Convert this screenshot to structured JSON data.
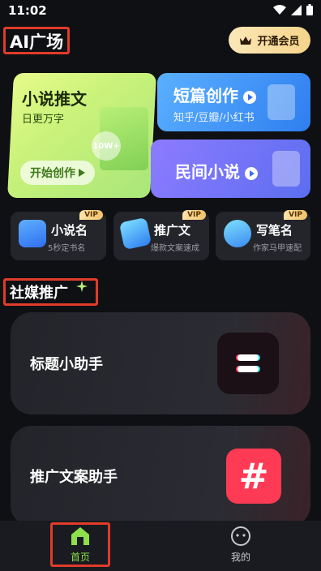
{
  "status": {
    "time": "11:02"
  },
  "header": {
    "title": "AI广场",
    "vip_button": "开通会员"
  },
  "cards": {
    "novel_promo": {
      "title": "小说推文",
      "subtitle": "日更万字",
      "badge": "10W+",
      "button": "开始创作"
    },
    "short_story": {
      "title": "短篇创作",
      "subtitle": "知乎/豆瓣/小红书"
    },
    "folk_novel": {
      "title": "民间小说"
    }
  },
  "small_tools": [
    {
      "name": "小说名",
      "desc": "5秒定书名",
      "vip": "VIP"
    },
    {
      "name": "推广文",
      "desc": "爆款文案速成",
      "vip": "VIP"
    },
    {
      "name": "写笔名",
      "desc": "作家马甲速配",
      "vip": "VIP"
    }
  ],
  "section2": {
    "title": "社媒推广"
  },
  "assistants": [
    {
      "label": "标题小助手"
    },
    {
      "label": "推广文案助手"
    }
  ],
  "nav": [
    {
      "label": "首页"
    },
    {
      "label": "我的"
    }
  ],
  "colors": {
    "accent_red": "#e23b2a",
    "vip_gold": "#f6d48a",
    "bg": "#0f1014"
  }
}
